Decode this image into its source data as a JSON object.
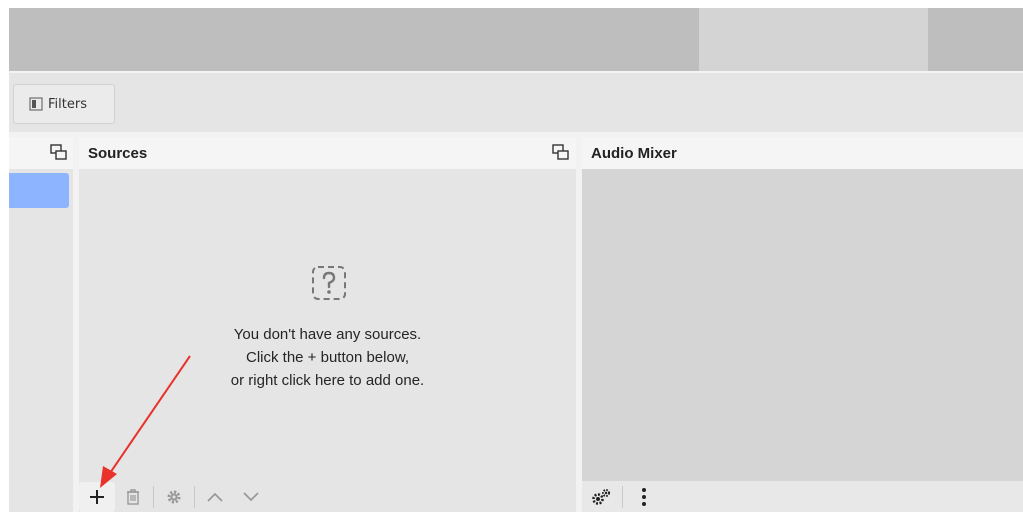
{
  "toolbar": {
    "filters_label": "Filters"
  },
  "sources": {
    "title": "Sources",
    "empty_lines": [
      "You don't have any sources.",
      "Click the + button below,",
      "or right click here to add one."
    ]
  },
  "audio_mixer": {
    "title": "Audio Mixer"
  },
  "icons": {
    "filters": "filters-icon",
    "undock": "undock-icon",
    "empty": "question-mark-icon",
    "add": "plus-icon",
    "remove": "trash-icon",
    "properties": "gear-icon",
    "move_up": "chevron-up-icon",
    "move_down": "chevron-down-icon",
    "advanced_audio": "gears-icon",
    "menu": "kebab-menu-icon"
  },
  "colors": {
    "selection": "#8cb4ff",
    "annotation_arrow": "#e8322a"
  }
}
